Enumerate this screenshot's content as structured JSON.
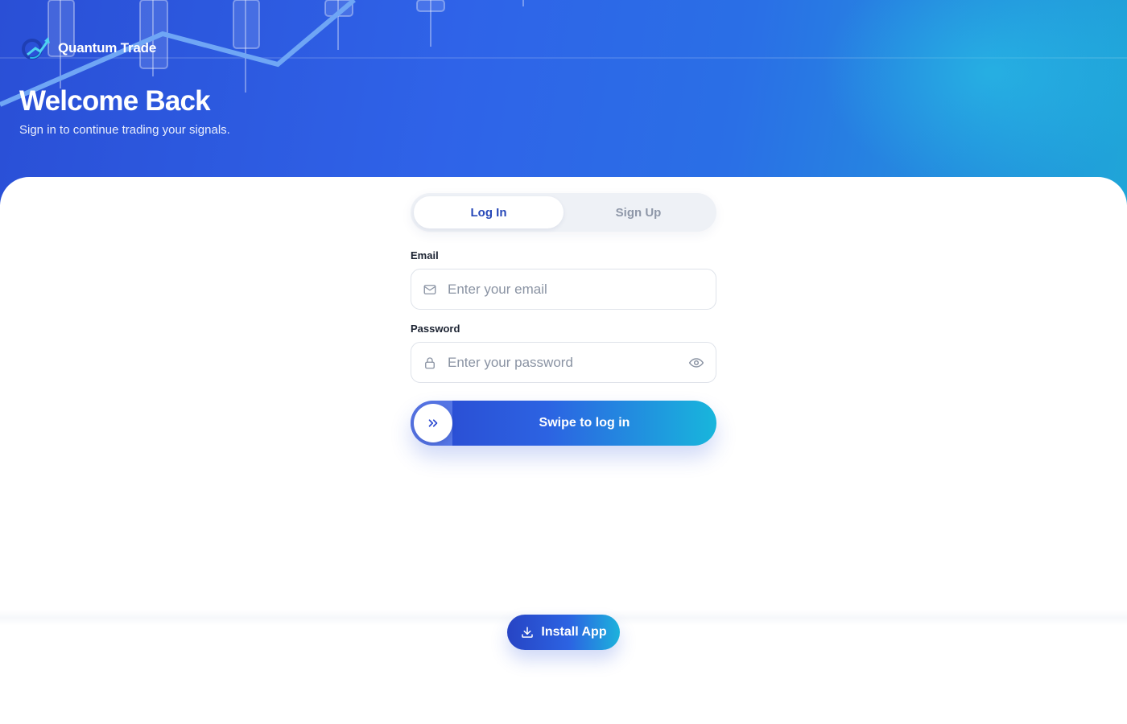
{
  "brand": {
    "name": "Quantum Trade",
    "logo_icon": "quantum-trade-logo"
  },
  "hero": {
    "title": "Welcome Back",
    "subtitle": "Sign in to continue trading your signals."
  },
  "auth_tabs": [
    {
      "label": "Log In",
      "active": true
    },
    {
      "label": "Sign Up",
      "active": false
    }
  ],
  "form": {
    "email": {
      "label": "Email",
      "placeholder": "Enter your email",
      "value": "",
      "icon": "mail-icon"
    },
    "password": {
      "label": "Password",
      "placeholder": "Enter your password",
      "value": "",
      "icon": "lock-icon",
      "toggle_icon": "eye-icon"
    }
  },
  "swipe": {
    "label": "Swipe to log in",
    "knob_icon": "double-chevron-right-icon"
  },
  "install": {
    "label": "Install App",
    "icon": "download-icon"
  },
  "colors": {
    "primary": "#2a48d0",
    "accent": "#18b6dc",
    "tab_active_text": "#2748b8"
  }
}
